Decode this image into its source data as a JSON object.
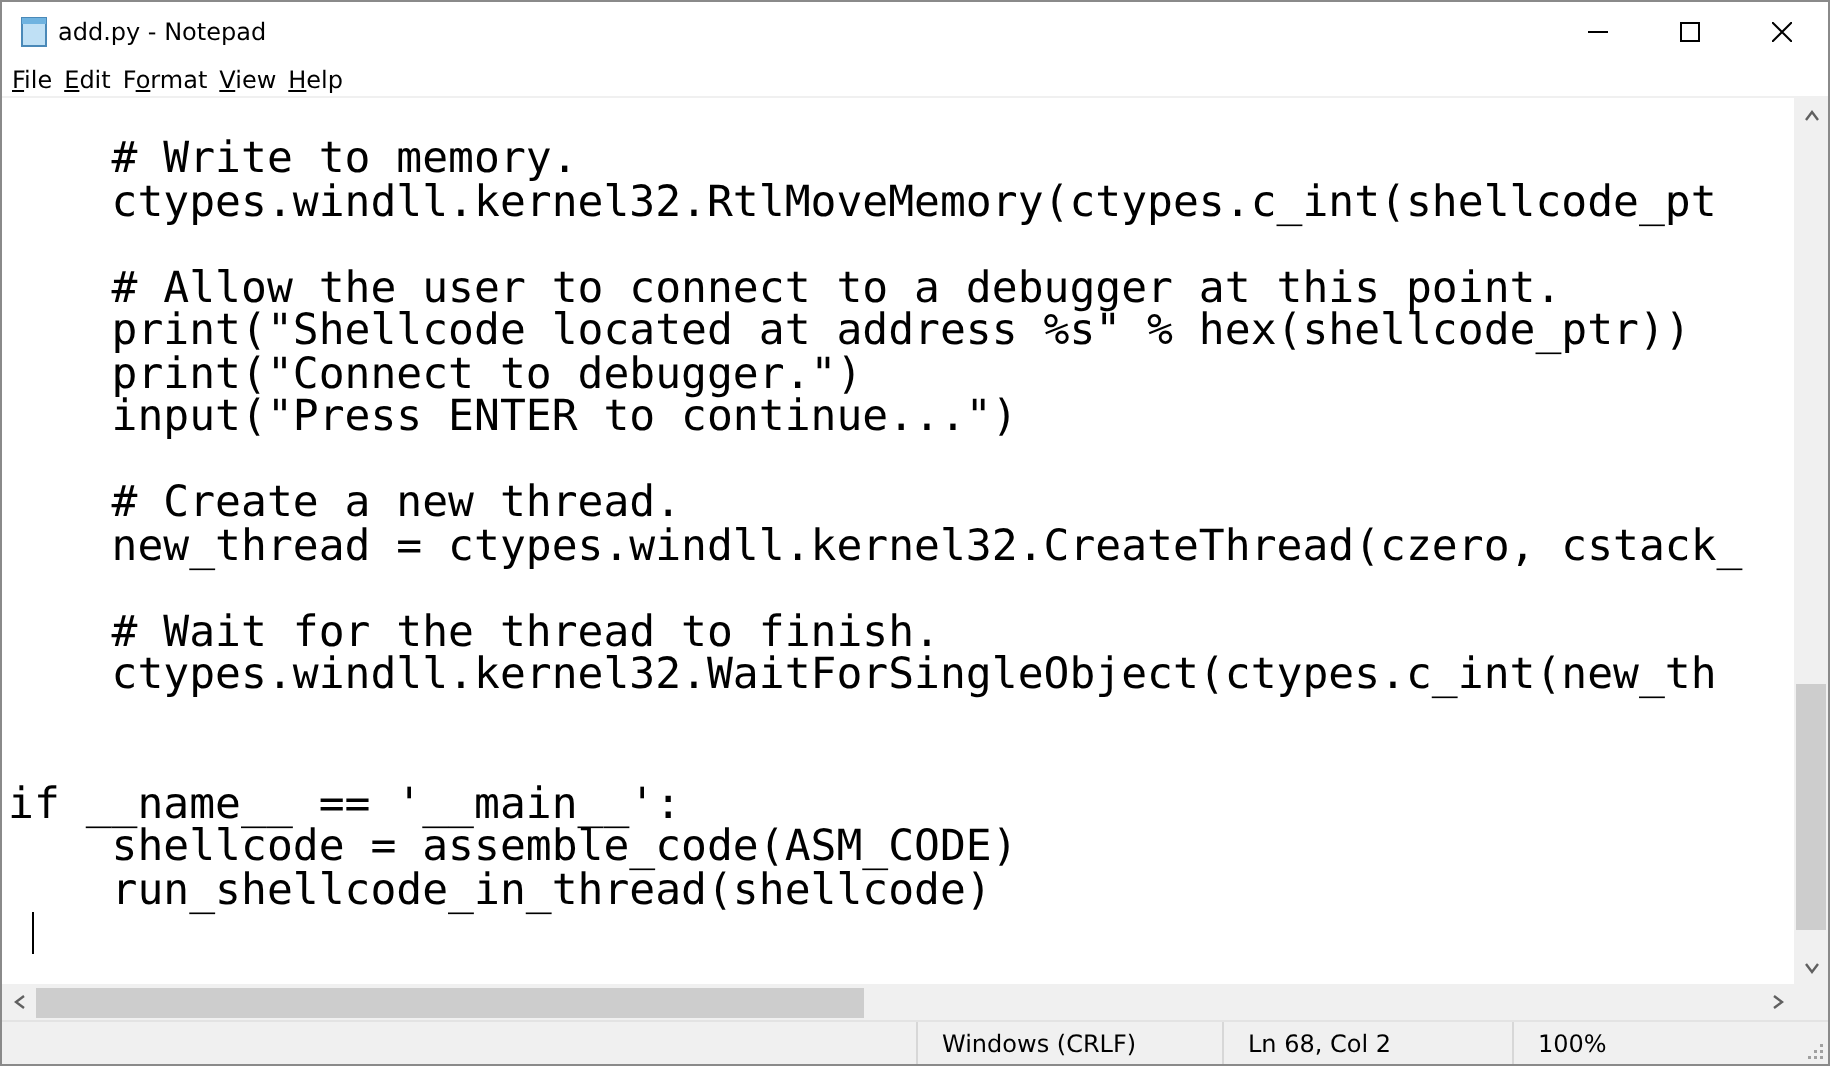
{
  "window": {
    "title": "add.py - Notepad"
  },
  "menu": [
    {
      "access_key": "F",
      "rest": "ile"
    },
    {
      "access_key": "E",
      "rest": "dit"
    },
    {
      "lead": "F",
      "access_key": "o",
      "rest": "rmat"
    },
    {
      "access_key": "V",
      "rest": "iew"
    },
    {
      "access_key": "H",
      "rest": "elp"
    }
  ],
  "editor": {
    "blocks": [
      {
        "kind": "nested",
        "lines": [
          "    # Write to memory.",
          "    ctypes.windll.kernel32.RtlMoveMemory(ctypes.c_int(shellcode_pt"
        ]
      },
      {
        "kind": "nested",
        "lines": [
          "    # Allow the user to connect to a debugger at this point.",
          "    print(\"Shellcode located at address %s\" % hex(shellcode_ptr))",
          "    print(\"Connect to debugger.\")",
          "    input(\"Press ENTER to continue...\")"
        ]
      },
      {
        "kind": "nested",
        "lines": [
          "    # Create a new thread.",
          "    new_thread = ctypes.windll.kernel32.CreateThread(czero, cstack_"
        ]
      },
      {
        "kind": "nested",
        "lines": [
          "    # Wait for the thread to finish.",
          "    ctypes.windll.kernel32.WaitForSingleObject(ctypes.c_int(new_th"
        ]
      },
      {
        "kind": "top-level",
        "lines": [
          "if __name__ == '__main__':",
          "    shellcode = assemble_code(ASM_CODE)",
          "    run_shellcode_in_thread(shellcode)"
        ]
      }
    ]
  },
  "status_bar": [
    "Windows (CRLF)",
    "Ln 68, Col 2",
    "100%"
  ]
}
